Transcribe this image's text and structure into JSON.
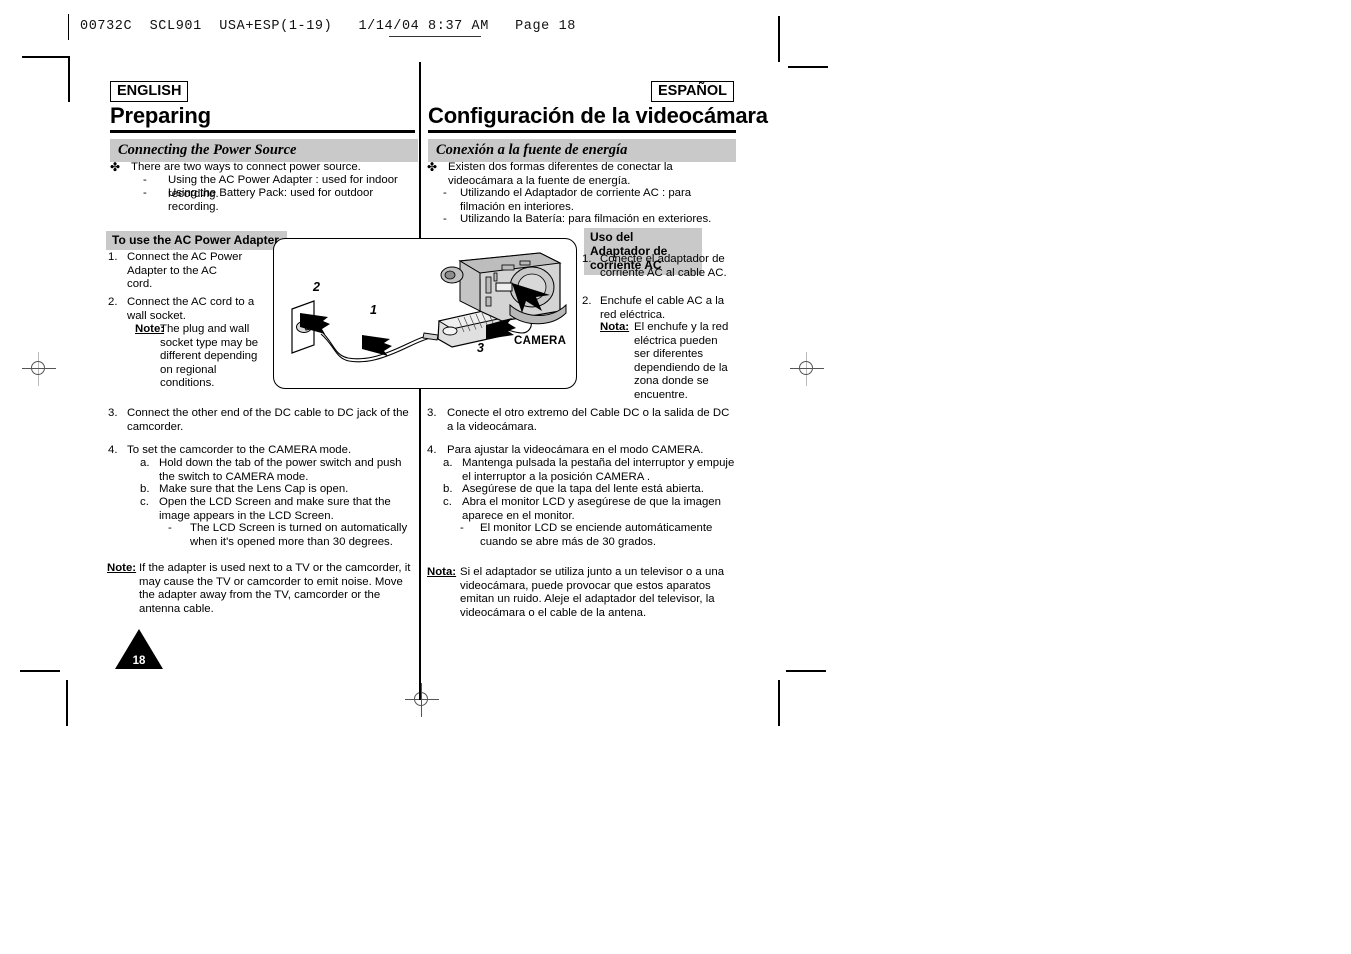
{
  "printer_header": {
    "text": "00732C  SCL901  USA+ESP(1-19)   1/14/04 8:37 AM   Page 18"
  },
  "left_column": {
    "language_tag": "ENGLISH",
    "title": "Preparing",
    "section_heading": "Connecting the Power Source",
    "intro": {
      "bullet_symbol": "✤",
      "lead": "There are two ways to connect power source.",
      "dashes": [
        "Using the AC Power Adapter : used for indoor recording.",
        "Using the Battery Pack: used for outdoor recording."
      ]
    },
    "subsection_heading": "To use the AC Power Adapter",
    "step1": {
      "number": "1.",
      "text": "Connect the AC Power Adapter to the AC cord."
    },
    "step2": {
      "number": "2.",
      "text": "Connect the AC cord to a wall socket.",
      "note_label": "Note:",
      "note_text": "The plug and wall socket type may be different depending on regional conditions."
    },
    "step3": {
      "number": "3.",
      "text": "Connect the other end of the DC cable to DC jack of the camcorder."
    },
    "step4": {
      "number": "4.",
      "text": "To set the camcorder to the CAMERA mode.",
      "sub": [
        {
          "label": "a.",
          "text": "Hold down the tab of the power switch and push the switch to CAMERA mode."
        },
        {
          "label": "b.",
          "text": "Make sure that the Lens Cap is open."
        },
        {
          "label": "c.",
          "text": "Open the LCD Screen and make sure that the image appears in the LCD Screen."
        }
      ],
      "sub_dash": "The LCD Screen is turned on automatically when it's opened more than 30 degrees."
    },
    "footnote": {
      "label": "Note:",
      "text": "If the adapter is used next to a TV or the camcorder, it may cause the TV or camcorder to emit noise. Move the adapter away from the TV, camcorder or the antenna cable."
    }
  },
  "right_column": {
    "language_tag": "ESPAÑOL",
    "title": "Configuración de la videocámara",
    "section_heading": "Conexión a la fuente de energía",
    "intro": {
      "bullet_symbol": "✤",
      "lead": "Existen dos formas diferentes de conectar la videocámara a la fuente de energía.",
      "dashes": [
        "Utilizando el Adaptador de corriente AC : para filmación en interiores.",
        "Utilizando la Batería: para filmación en exteriores."
      ]
    },
    "subsection_heading": "Uso del Adaptador de corriente AC",
    "step1": {
      "number": "1.",
      "text": "Conecte el adaptador de corriente AC al cable AC."
    },
    "step2": {
      "number": "2.",
      "text": "Enchufe el cable AC a la red eléctrica.",
      "note_label": "Nota:",
      "note_text": "El enchufe y la red eléctrica pueden ser diferentes dependiendo de la zona donde se encuentre."
    },
    "step3": {
      "number": "3.",
      "text": "Conecte el otro extremo del Cable DC o la salida de DC a la videocámara."
    },
    "step4": {
      "number": "4.",
      "text": "Para ajustar la videocámara en el modo CAMERA.",
      "sub": [
        {
          "label": "a.",
          "text": "Mantenga pulsada la pestaña del interruptor y empuje el interruptor a la posición CAMERA ."
        },
        {
          "label": "b.",
          "text": "Asegúrese de que la tapa del lente está abierta."
        },
        {
          "label": "c.",
          "text": "Abra el monitor LCD y asegúrese de que la imagen aparece en el monitor."
        }
      ],
      "sub_dash": "El monitor LCD se enciende automáticamente cuando se abre más de 30 grados."
    },
    "footnote": {
      "label": "Nota:",
      "text": "Si el adaptador se utiliza junto a un televisor o a una videocámara, puede provocar que estos aparatos emitan un ruido. Aleje el adaptador del televisor, la videocámara o el cable de la antena."
    }
  },
  "illustration": {
    "step_labels": {
      "one": "1",
      "two": "2",
      "three": "3"
    },
    "camera_label": "CAMERA"
  },
  "page_number": "18"
}
